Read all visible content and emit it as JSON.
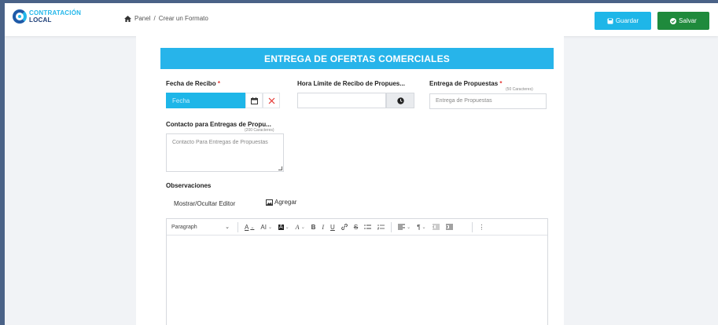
{
  "header": {
    "logo_line1": "CONTRATACIÓN",
    "logo_line2": "LOCAL",
    "breadcrumb_home": "Panel",
    "breadcrumb_sep": "/",
    "breadcrumb_current": "Crear un Formato",
    "guardar_label": "Guardar",
    "salvar_label": "Salvar"
  },
  "section": {
    "title": "ENTREGA DE OFERTAS COMERCIALES"
  },
  "form": {
    "fecha_label": "Fecha de Recibo",
    "fecha_required": "*",
    "fecha_placeholder": "Fecha",
    "hora_label": "Hora Límite de Recibo de Propues...",
    "entrega_label": "Entrega de Propuestas",
    "entrega_required": "*",
    "entrega_hint": "(50 Caracteres)",
    "entrega_placeholder": "Entrega de Propuestas",
    "contacto_label": "Contacto para Entregas de Propu...",
    "contacto_hint": "(200 Caracteres)",
    "contacto_placeholder": "Contacto Para Entregas de Propuestas",
    "observaciones_label": "Observaciones",
    "mostrar_label": "Mostrar/Ocultar Editor",
    "agregar_label": "Agregar"
  },
  "toolbar": {
    "paragraph": "Paragraph",
    "font_color": "A",
    "font_size": "AI",
    "highlight": "A",
    "styles": "A",
    "bold": "B",
    "italic": "I",
    "underline": "U",
    "strike": "S",
    "more": "⋮"
  },
  "colors": {
    "accent": "#27b4ea",
    "save": "#1f8a3c",
    "background": "#4a6287"
  }
}
